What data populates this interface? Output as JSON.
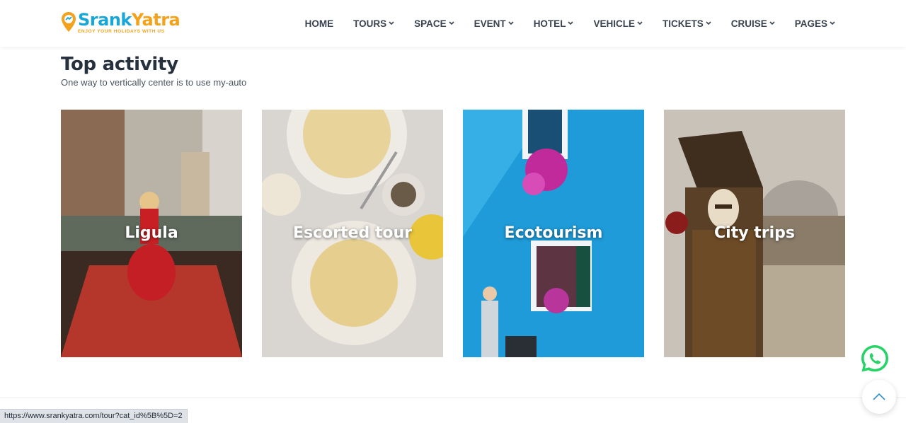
{
  "brand": {
    "name_part1": "Srank",
    "name_part2": "Yatra",
    "tagline": "ENJOY YOUR HOLIDAYS WITH US",
    "color_primary": "#18a5d8",
    "color_accent": "#f4a11b"
  },
  "nav": {
    "items": [
      {
        "label": "HOME",
        "dropdown": false
      },
      {
        "label": "TOURS",
        "dropdown": true
      },
      {
        "label": "SPACE",
        "dropdown": true
      },
      {
        "label": "EVENT",
        "dropdown": true
      },
      {
        "label": "HOTEL",
        "dropdown": true
      },
      {
        "label": "VEHICLE",
        "dropdown": true
      },
      {
        "label": "TICKETS",
        "dropdown": true
      },
      {
        "label": "CRUISE",
        "dropdown": true
      },
      {
        "label": "PAGES",
        "dropdown": true
      }
    ]
  },
  "section": {
    "title": "Top activity",
    "subtitle": "One way to vertically center is to use my-auto"
  },
  "cards": [
    {
      "label": "Ligula",
      "image": "venice-gondola-photo"
    },
    {
      "label": "Escorted tour",
      "image": "pasta-dishes-photo"
    },
    {
      "label": "Ecotourism",
      "image": "blue-wall-flowers-photo"
    },
    {
      "label": "City trips",
      "image": "venice-carnival-mask-photo"
    }
  ],
  "status_bar": {
    "url": "https://www.srankyatra.com/tour?cat_id%5B%5D=2"
  },
  "floating": {
    "whatsapp_icon": "whatsapp-icon",
    "scroll_top_icon": "chevron-up-icon",
    "whatsapp_color": "#25d366"
  }
}
